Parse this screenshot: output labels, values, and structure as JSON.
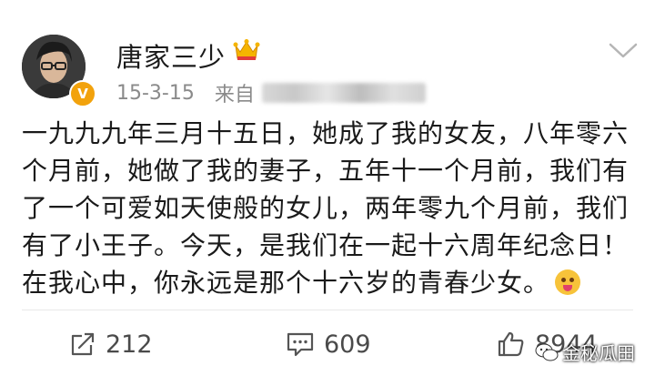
{
  "post": {
    "author": "唐家三少",
    "date": "15-3-15",
    "source_prefix": "来自",
    "content": "一九九九年三月十五日，她成了我的女友，八年零六个月前，她做了我的妻子，五年十一个月前，我们有了一个可爱如天使般的女儿，两年零九个月前，我们有了小王子。今天，是我们在一起十六周年纪念日！在我心中，你永远是那个十六岁的青春少女。"
  },
  "badges": {
    "verified": "V"
  },
  "actions": {
    "repost_count": "212",
    "comment_count": "609",
    "like_count": "8944"
  },
  "watermark": {
    "text": "金秘瓜田"
  },
  "icons": [
    "crown-icon",
    "chevron-down-icon",
    "repost-icon",
    "comment-icon",
    "like-icon",
    "emoji-icon",
    "wechat-icon"
  ],
  "colors": {
    "accent_gold": "#f2a20c",
    "meta_gray": "#8a8a8a",
    "text": "#1a1a1a"
  }
}
